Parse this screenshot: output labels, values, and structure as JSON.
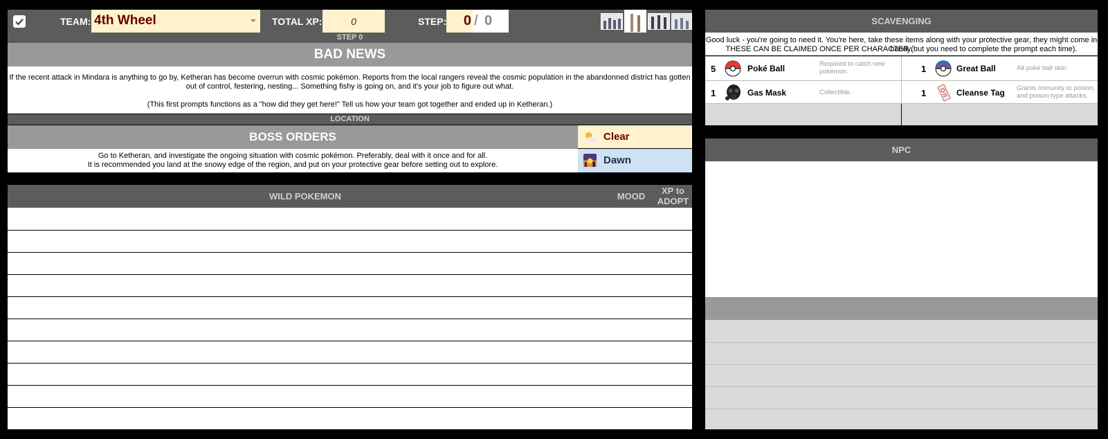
{
  "top_bar": {
    "team_label": "TEAM:",
    "team_value": "4th Wheel",
    "total_xp_label": "TOTAL XP:",
    "total_xp_value": "0",
    "step_label": "STEP:",
    "step_current": "0",
    "step_separator": "/",
    "step_total": "0"
  },
  "step": {
    "header": "STEP 0",
    "title": "BAD NEWS",
    "text_1": "If the recent attack in Mindara is anything to go by, Ketheran has become overrun with cosmic pokémon. Reports from the local rangers reveal the cosmic population in the abandonned district has gotten out of control, festering, nesting... Something fishy is going on, and it's your job to figure out what.",
    "text_2": "(This first prompts functions as a \"how did they get here!\" Tell us how your team got together and ended up in Ketheran.)"
  },
  "location": {
    "header": "LOCATION",
    "boss_orders_title": "BOSS ORDERS",
    "boss_orders_line_1": "Go to Ketheran, and investigate the ongoing situation with cosmic pokémon. Preferably, deal with it once and for all.",
    "boss_orders_line_2": "It is recommended you land at the snowy edge of the region, and put on your protective gear before setting out to explore.",
    "weather": "Clear",
    "time": "Dawn"
  },
  "wild_pokemon": {
    "header": "WILD POKEMON",
    "mood_header": "MOOD",
    "xp_header_1": "XP to",
    "xp_header_2": "ADOPT",
    "rows": 10
  },
  "scavenging": {
    "header": "SCAVENGING",
    "intro_1": "Good luck - you're going to need it. You're here, take these items along with your protective gear, they might come in handy.",
    "intro_2": "THESE CAN BE CLAIMED ONCE PER CHARACTER (but you need to complete the prompt each time).",
    "items": [
      {
        "count": "5",
        "name": "Poké Ball",
        "desc": "Required to catch new pokémon."
      },
      {
        "count": "1",
        "name": "Great Ball",
        "desc": "Alt poké ball skin."
      },
      {
        "count": "1",
        "name": "Gas Mask",
        "desc": "Collectible."
      },
      {
        "count": "1",
        "name": "Cleanse Tag",
        "desc": "Grants immunity to poison, and poison-type attacks."
      }
    ]
  },
  "npc": {
    "header": "NPC"
  },
  "colors": {
    "dark_band": "#5c5c5c",
    "mid_band": "#999999",
    "team_fill": "#fff2cc",
    "team_text": "#660000",
    "dawn_fill": "#cfe2f3",
    "light_gray": "#d9d9d9"
  }
}
